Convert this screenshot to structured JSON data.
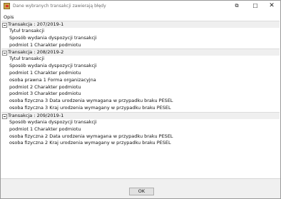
{
  "window": {
    "title": "Dane wybranych transakcji zawierają błędy",
    "restore_glyph": "⧉",
    "maximize_glyph": "☐",
    "close_glyph": "✕"
  },
  "header": {
    "column_label": "Opis"
  },
  "groups": [
    {
      "title": "Transakcja : 207/2019-1",
      "items": [
        "Tytuł transakcji",
        "Sposób wydania dyspozycji transakcji",
        "podmiot 1 Charakter podmiotu"
      ]
    },
    {
      "title": "Transakcja : 208/2019-2",
      "items": [
        "Tytuł transakcji",
        "Sposób wydania dyspozycji transakcji",
        "podmiot 1 Charakter podmiotu",
        "osoba prawna 1 Forma organizacyjna",
        "podmiot 2 Charakter podmiotu",
        "podmiot 3 Charakter podmiotu",
        "osoba fizyczna 3 Data urodzenia wymagana w przypadku braku PESEL",
        "osoba fizyczna 3 Kraj urodzenia wymagany w przypadku braku PESEL"
      ]
    },
    {
      "title": "Transakcja : 209/2019-1",
      "items": [
        "Sposób wydania dyspozycji transakcji",
        "podmiot 1 Charakter podmiotu",
        "osoba fizyczna 2 Data urodzenia wymagana w przypadku braku PESEL",
        "osoba fizyczna 2 Kraj urodzenia wymagany w przypadku braku PESEL"
      ]
    }
  ],
  "footer": {
    "ok_label": "OK"
  }
}
